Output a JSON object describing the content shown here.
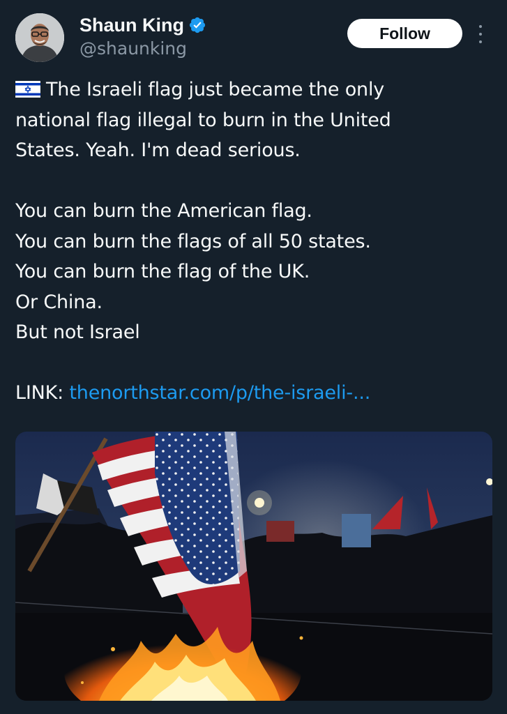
{
  "author": {
    "display_name": "Shaun King",
    "handle": "@shaunking",
    "verified": true,
    "avatar_icon": "profile-photo"
  },
  "actions": {
    "follow_label": "Follow",
    "more_icon": "more-vertical-icon"
  },
  "tweet": {
    "emoji": "israel-flag-emoji",
    "lines_para1": [
      "The Israeli flag just became the only",
      "national flag illegal to burn in the United",
      "States. Yeah. I'm dead serious."
    ],
    "lines_para2": [
      "You can burn the American flag.",
      "You can burn the flags of all 50 states.",
      "You can burn the flag of the UK.",
      "Or China.",
      "But not Israel"
    ],
    "link_prefix": "LINK: ",
    "link_text": "thenorthstar.com/p/the-israeli-..."
  },
  "media": {
    "kind": "photo",
    "subject": "burning-american-flag-at-night-protest"
  },
  "colors": {
    "background": "#15202b",
    "text": "#f7f9f9",
    "secondary": "#8b98a5",
    "link": "#1d9bf0",
    "verified_badge": "#1d9bf0"
  }
}
